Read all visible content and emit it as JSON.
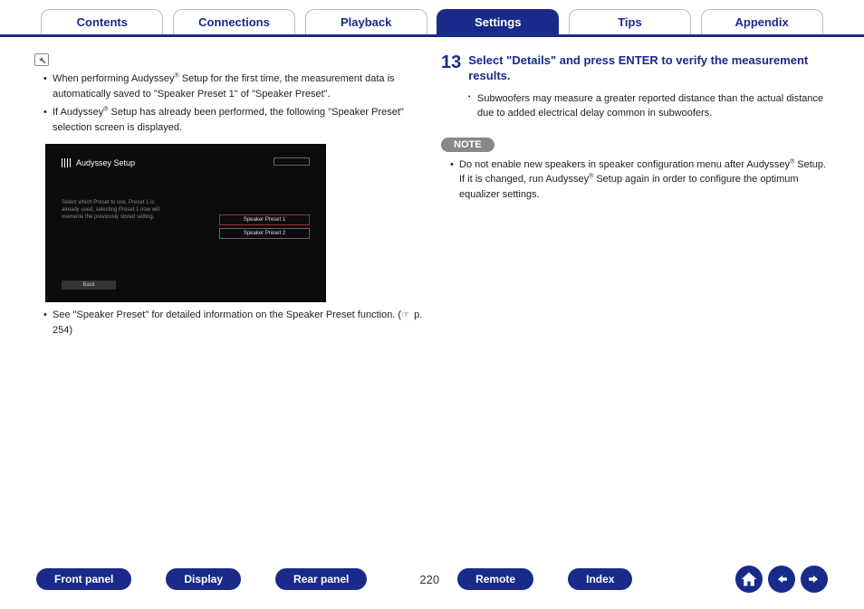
{
  "tabs": {
    "items": [
      {
        "label": "Contents"
      },
      {
        "label": "Connections"
      },
      {
        "label": "Playback"
      },
      {
        "label": "Settings",
        "active": true
      },
      {
        "label": "Tips"
      },
      {
        "label": "Appendix"
      }
    ]
  },
  "left": {
    "bullet1_a": "When performing Audyssey",
    "bullet1_b": " Setup for the first time, the measurement data is automatically saved to \"Speaker Preset 1\" of \"Speaker Preset\".",
    "bullet2_a": "If Audyssey",
    "bullet2_b": " Setup has already been performed, the following \"Speaker Preset\" selection screen is displayed.",
    "screenshot": {
      "title": "Audyssey Setup",
      "desc": "Select which Preset to use. Preset 1 is already used; selecting Preset 1 now will overwrite the previously stored setting.",
      "preset1": "Speaker Preset 1",
      "preset2": "Speaker Preset 2",
      "back": "Back"
    },
    "footnote_a": "See \"Speaker Preset\" for detailed information on the Speaker Preset function.  (",
    "footnote_b": " p. 254)"
  },
  "right": {
    "step_num": "13",
    "step_title": "Select \"Details\" and press ENTER to verify the measurement results.",
    "sub1": "Subwoofers may measure a greater reported distance than the actual distance due to added electrical delay common in subwoofers.",
    "note_label": "NOTE",
    "note_a": "Do not enable new speakers in speaker configuration menu after Audyssey",
    "note_b": " Setup. If it is changed, run Audyssey",
    "note_c": " Setup again in order to configure the optimum equalizer settings."
  },
  "footer": {
    "buttons": [
      "Front panel",
      "Display",
      "Rear panel"
    ],
    "page": "220",
    "buttons2": [
      "Remote",
      "Index"
    ]
  },
  "reg": "®"
}
